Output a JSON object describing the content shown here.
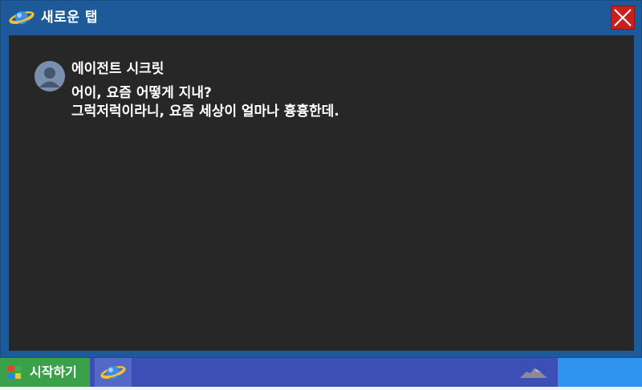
{
  "window": {
    "title": "새로운 탭",
    "icon": "browser-planet-icon",
    "close_icon": "close-x-icon"
  },
  "message": {
    "sender": "에이전트 시크릿",
    "lines": [
      "어이, 요즘 어떻게 지내?",
      "그럭저럭이라니, 요즘 세상이 얼마나 흉흉한데."
    ],
    "avatar_icon": "user-avatar-icon"
  },
  "taskbar": {
    "start_label": "시작하기",
    "start_icon": "windows-logo-icon",
    "tasks": [
      {
        "icon": "browser-planet-icon"
      }
    ],
    "tray_icon": "cloud-icon"
  },
  "colors": {
    "titlebar": "#1e5a99",
    "content_bg": "#272727",
    "close_button": "#c8201e",
    "taskbar": "#3c4fb5",
    "start_button": "#3aa14a",
    "tray_box": "#2f93f0"
  }
}
